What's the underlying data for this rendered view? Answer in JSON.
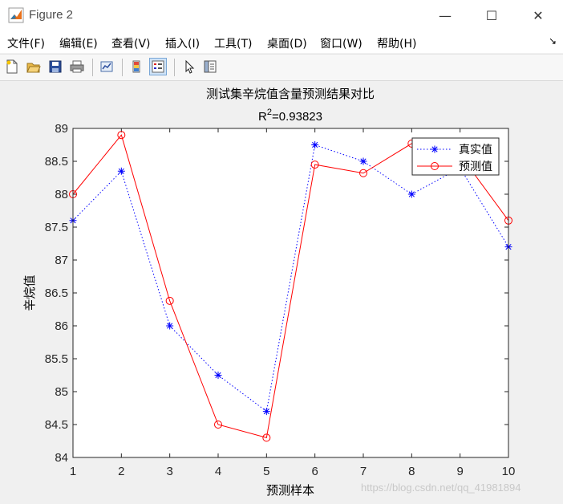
{
  "window": {
    "title": "Figure 2",
    "minimize_glyph": "—",
    "maximize_glyph": "☐",
    "close_glyph": "✕"
  },
  "menu": {
    "items": [
      "文件(F)",
      "编辑(E)",
      "查看(V)",
      "插入(I)",
      "工具(T)",
      "桌面(D)",
      "窗口(W)",
      "帮助(H)"
    ],
    "overflow_glyph": "↘"
  },
  "toolbar": {
    "icons": [
      "new-figure-icon",
      "open-file-icon",
      "save-icon",
      "print-icon",
      "link-plot-icon",
      "colorbar-icon",
      "legend-icon",
      "pointer-icon",
      "property-inspector-icon"
    ]
  },
  "chart_data": {
    "type": "line",
    "title": "测试集辛烷值含量预测结果对比",
    "subtitle_base": "R",
    "subtitle_sup": "2",
    "subtitle_rest": "=0.93823",
    "xlabel": "预测样本",
    "ylabel": "辛烷值",
    "x": [
      1,
      2,
      3,
      4,
      5,
      6,
      7,
      8,
      9,
      10
    ],
    "xlim": [
      1,
      10
    ],
    "ylim": [
      84,
      89
    ],
    "xticks": [
      "1",
      "2",
      "3",
      "4",
      "5",
      "6",
      "7",
      "8",
      "9",
      "10"
    ],
    "yticks": [
      "84",
      "84.5",
      "85",
      "85.5",
      "86",
      "86.5",
      "87",
      "87.5",
      "88",
      "88.5",
      "89"
    ],
    "grid": false,
    "legend_position": "top-right",
    "series": [
      {
        "name": "真实值",
        "values": [
          87.6,
          88.35,
          86.0,
          85.25,
          84.7,
          88.75,
          88.5,
          88.0,
          88.4,
          87.2
        ],
        "color": "#0000ff",
        "marker": "asterisk",
        "line": "dotted"
      },
      {
        "name": "预测值",
        "values": [
          88.0,
          88.9,
          86.38,
          84.5,
          84.3,
          88.45,
          88.32,
          88.77,
          88.6,
          87.6
        ],
        "color": "#ff0000",
        "marker": "circle",
        "line": "solid"
      }
    ]
  },
  "watermark": "https://blog.csdn.net/qq_41981894"
}
